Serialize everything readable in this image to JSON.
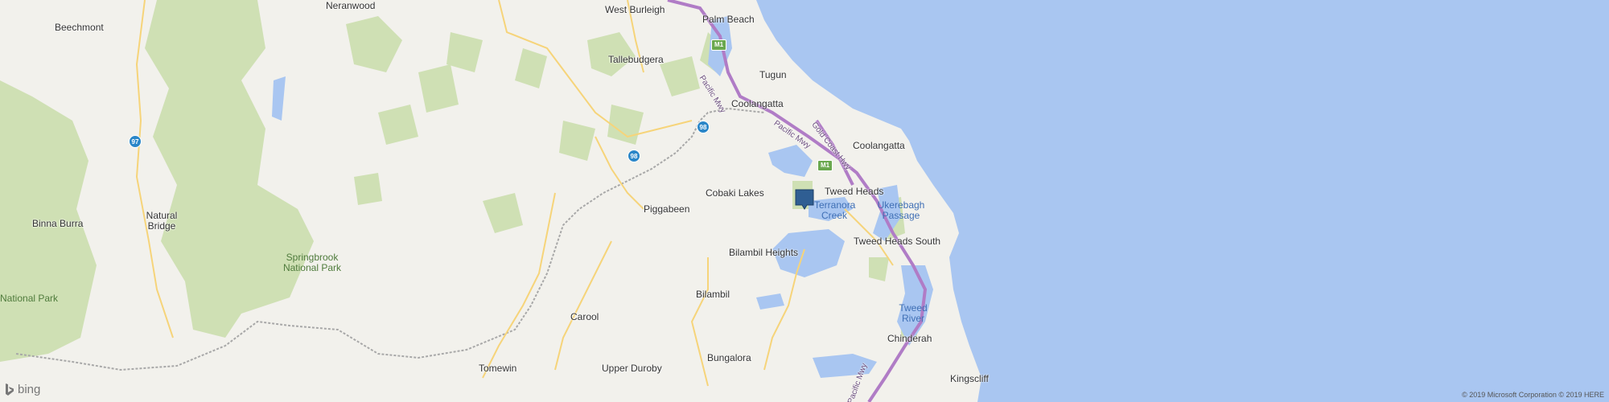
{
  "map": {
    "colors": {
      "land": "#f2f1ec",
      "forest": "#cfe0b4",
      "water": "#a9c6f1",
      "highway": "#b07cc6",
      "road": "#f6d47a",
      "border": "#a8a8a8",
      "marker": "#2f5e93"
    },
    "places": [
      {
        "id": "neranwood",
        "label": "Neranwood"
      },
      {
        "id": "west-burleigh",
        "label": "West Burleigh"
      },
      {
        "id": "palm-beach",
        "label": "Palm Beach"
      },
      {
        "id": "beechmont",
        "label": "Beechmont"
      },
      {
        "id": "tallebudgera",
        "label": "Tallebudgera"
      },
      {
        "id": "tugun",
        "label": "Tugun"
      },
      {
        "id": "coolangatta-1",
        "label": "Coolangatta"
      },
      {
        "id": "coolangatta-2",
        "label": "Coolangatta"
      },
      {
        "id": "cobaki-lakes",
        "label": "Cobaki Lakes"
      },
      {
        "id": "tweed-heads",
        "label": "Tweed Heads"
      },
      {
        "id": "piggabeen",
        "label": "Piggabeen"
      },
      {
        "id": "binna-burra",
        "label": "Binna Burra"
      },
      {
        "id": "natural-bridge",
        "label": "Natural Bridge"
      },
      {
        "id": "bilambil-heights",
        "label": "Bilambil Heights"
      },
      {
        "id": "tweed-heads-south",
        "label": "Tweed Heads South"
      },
      {
        "id": "bilambil",
        "label": "Bilambil"
      },
      {
        "id": "carool",
        "label": "Carool"
      },
      {
        "id": "chinderah",
        "label": "Chinderah"
      },
      {
        "id": "tomewin",
        "label": "Tomewin"
      },
      {
        "id": "upper-duroby",
        "label": "Upper Duroby"
      },
      {
        "id": "bungalora",
        "label": "Bungalora"
      },
      {
        "id": "kingscliff",
        "label": "Kingscliff"
      }
    ],
    "water_labels": [
      {
        "id": "terranora-creek",
        "label": "Terranora Creek"
      },
      {
        "id": "ukerebagh-passage",
        "label": "Ukerebagh Passage"
      },
      {
        "id": "tweed-river",
        "label": "Tweed River"
      }
    ],
    "park_labels": [
      {
        "id": "springbrook",
        "label": "Springbrook National Park"
      },
      {
        "id": "national-park",
        "label": "National Park"
      }
    ],
    "road_labels": [
      {
        "id": "pacific-mwy-1",
        "label": "Pacific Mwy"
      },
      {
        "id": "pacific-mwy-2",
        "label": "Pacific Mwy"
      },
      {
        "id": "gold-coast-hwy",
        "label": "Gold Coast Hwy"
      },
      {
        "id": "pacific-mwy-3",
        "label": "Pacific Mwy"
      }
    ],
    "shields": [
      {
        "id": "r97",
        "label": "97"
      },
      {
        "id": "r98a",
        "label": "98"
      },
      {
        "id": "r98b",
        "label": "98"
      },
      {
        "id": "m1a",
        "label": "M1"
      },
      {
        "id": "m1b",
        "label": "M1"
      }
    ],
    "logo": "bing",
    "attribution": "© 2019 Microsoft Corporation © 2019 HERE"
  }
}
